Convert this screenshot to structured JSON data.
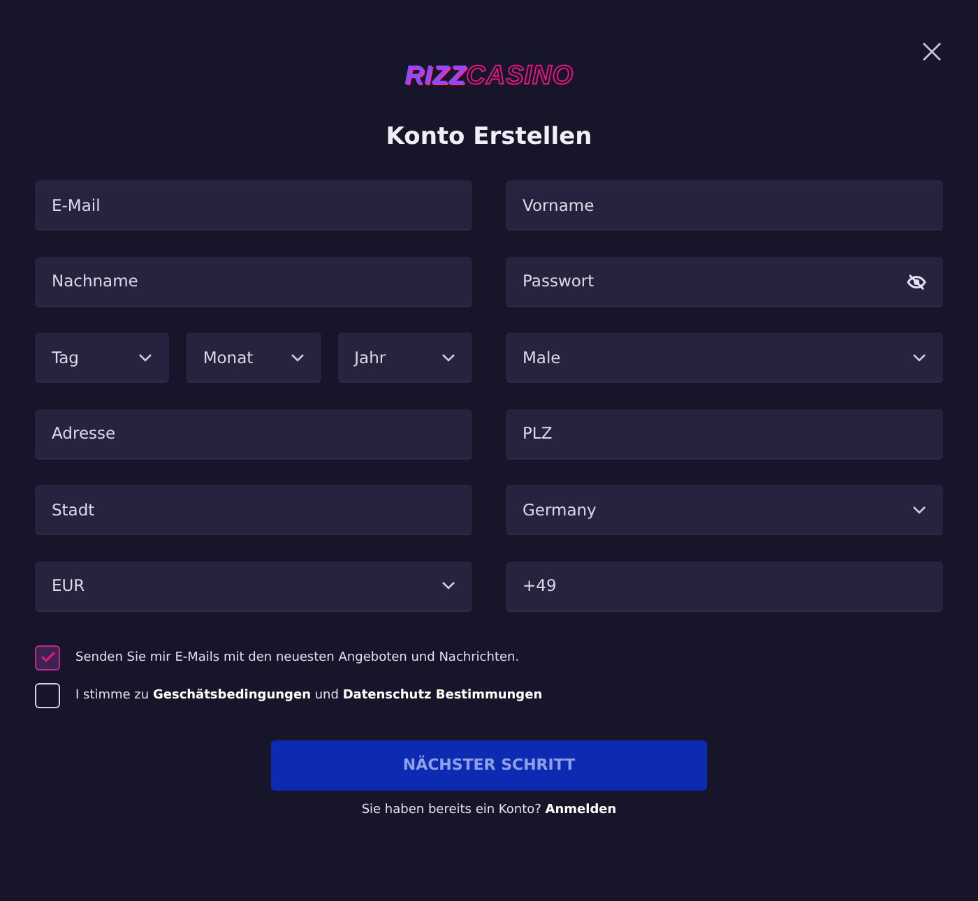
{
  "logo": {
    "first": "RIZZ",
    "second": "CASINO"
  },
  "title": "Konto Erstellen",
  "rows": [
    {
      "left": [
        {
          "kind": "input",
          "placeholder": "E-Mail"
        }
      ],
      "right": [
        {
          "kind": "input",
          "placeholder": "Vorname"
        }
      ]
    },
    {
      "left": [
        {
          "kind": "input",
          "placeholder": "Nachname"
        }
      ],
      "right": [
        {
          "kind": "password",
          "placeholder": "Passwort"
        }
      ]
    },
    {
      "left": [
        {
          "kind": "select",
          "value": "Tag"
        },
        {
          "kind": "select",
          "value": "Monat"
        },
        {
          "kind": "select",
          "value": "Jahr"
        }
      ],
      "right": [
        {
          "kind": "select",
          "value": "Male"
        }
      ]
    },
    {
      "left": [
        {
          "kind": "input",
          "placeholder": "Adresse"
        }
      ],
      "right": [
        {
          "kind": "input",
          "placeholder": "PLZ"
        }
      ]
    },
    {
      "left": [
        {
          "kind": "input",
          "placeholder": "Stadt"
        }
      ],
      "right": [
        {
          "kind": "select",
          "value": "Germany"
        }
      ]
    },
    {
      "left": [
        {
          "kind": "select",
          "value": "EUR"
        }
      ],
      "right": [
        {
          "kind": "input",
          "value": "+49"
        }
      ]
    }
  ],
  "consents": [
    {
      "text": "Senden Sie mir E-Mails mit den neuesten Angeboten und Nachrichten.",
      "checked": true
    },
    {
      "text": "I stimme zu **Geschätsbedingungen** und **Datenschutz Bestimmungen**",
      "checked": false
    }
  ],
  "submit": "NÄCHSTER SCHRITT",
  "login": {
    "text": "Sie haben bereits ein Konto?",
    "link": "Anmelden"
  }
}
